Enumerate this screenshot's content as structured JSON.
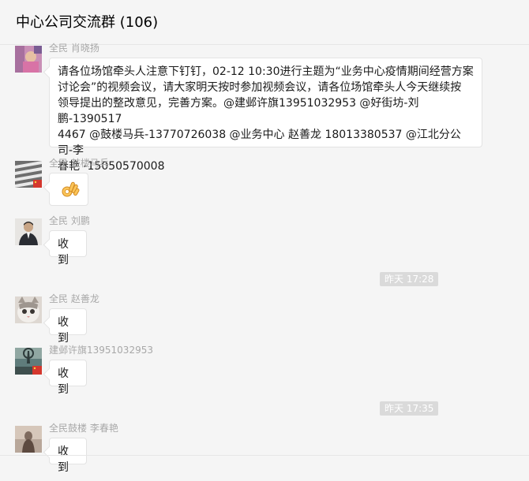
{
  "header": {
    "title": "中心公司交流群 (106)"
  },
  "messages": [
    {
      "sender": "全民 肖晓扬",
      "text": "请各位场馆牵头人注意下钉钉，02-12 10:30进行主题为“业务中心疫情期间经营方案讨论会”的视频会议，请大家明天按时参加视频会议，请各位场馆牵头人今天继续按领导提出的整改意见，完善方案。@建邺许旗13951032953 @好街坊-刘鹏-1390517 4467 @鼓楼马兵-13770726038 @业务中心  赵善龙  18013380537 @江北分公司-李春艳 -15050570008",
      "lines": [
        "请各位场馆牵头人注意下钉钉，02-12 10:30进行主题为“业务中心疫情期间经营方案",
        "讨论会”的视频会议，请大家明天按时参加视频会议，请各位场馆牵头人今天继续按",
        "领导提出的整改意见，完善方案。@建邺许旗13951032953 @好街坊-刘鹏-1390517",
        "4467 @鼓楼马兵-13770726038 @业务中心  赵善龙  18013380537 @江北分公司-李",
        "春艳 -15050570008"
      ]
    },
    {
      "sender": "全民 鼓楼马兵",
      "emoji": "ok-hand-emoji"
    },
    {
      "sender": "全民 刘鹏",
      "text": "收到"
    },
    {
      "sender": "全民 赵善龙",
      "text": "收到"
    },
    {
      "sender": "建邺许旗13951032953",
      "text": "收到"
    },
    {
      "sender": "全民鼓楼 李春艳",
      "text": "收到"
    }
  ],
  "timestamps": [
    "昨天 17:28",
    "昨天 17:35"
  ],
  "colors": {
    "background": "#f5f5f5",
    "bubble": "#ffffff",
    "sender_text": "#a8a8a8",
    "timestamp_bg": "#dadada"
  }
}
